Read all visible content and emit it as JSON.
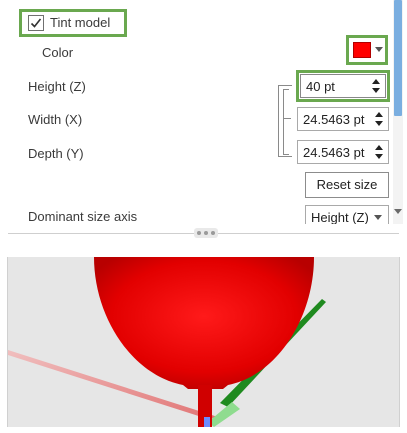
{
  "tint_model": {
    "label": "Tint model",
    "checked": true
  },
  "color": {
    "label": "Color",
    "value": "#ff0000"
  },
  "height": {
    "label": "Height (Z)",
    "value": "40 pt"
  },
  "width": {
    "label": "Width (X)",
    "value": "24.5463 pt"
  },
  "depth": {
    "label": "Depth (Y)",
    "value": "24.5463 pt"
  },
  "reset_button": {
    "label": "Reset size"
  },
  "dominant_axis": {
    "label": "Dominant size axis",
    "value": "Height (Z)"
  },
  "colors": {
    "highlight": "#6aa84f",
    "model": "#e00000",
    "scroll_thumb": "#7aaee0",
    "preview_bg": "#e6e6e6"
  }
}
